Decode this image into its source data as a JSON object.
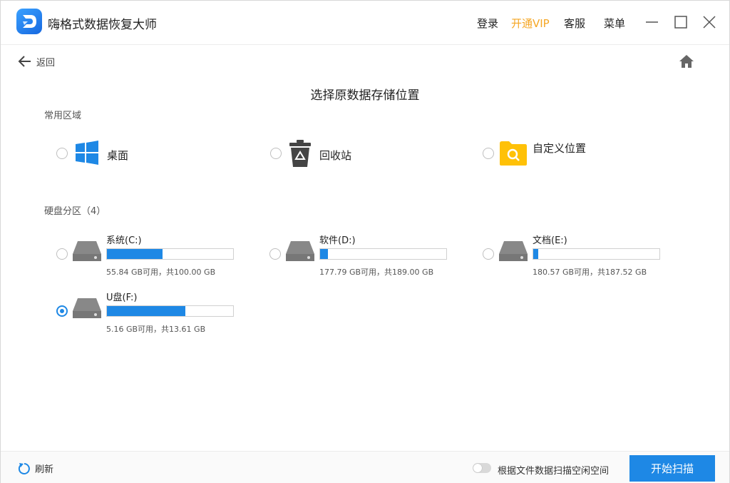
{
  "app": {
    "title": "嗨格式数据恢复大师"
  },
  "topnav": {
    "login": "登录",
    "vip": "开通VIP",
    "service": "客服",
    "menu": "菜单"
  },
  "nav": {
    "back": "返回"
  },
  "page": {
    "title": "选择原数据存储位置"
  },
  "common": {
    "label": "常用区域",
    "items": [
      {
        "label": "桌面",
        "icon": "windows-icon"
      },
      {
        "label": "回收站",
        "icon": "recycle-bin-icon"
      },
      {
        "label": "自定义位置",
        "icon": "custom-folder-icon"
      }
    ]
  },
  "partitions": {
    "label": "硬盘分区（4）",
    "items": [
      {
        "name": "系统(C:)",
        "capacity": "55.84 GB可用，共100.00 GB",
        "used_fraction": 0.44,
        "selected": false
      },
      {
        "name": "软件(D:)",
        "capacity": "177.79 GB可用，共189.00 GB",
        "used_fraction": 0.06,
        "selected": false
      },
      {
        "name": "文档(E:)",
        "capacity": "180.57 GB可用，共187.52 GB",
        "used_fraction": 0.04,
        "selected": false
      },
      {
        "name": "U盘(F:)",
        "capacity": "5.16 GB可用，共13.61 GB",
        "used_fraction": 0.62,
        "selected": true
      }
    ]
  },
  "footer": {
    "refresh": "刷新",
    "toggle_label": "根据文件数据扫描空闲空间",
    "toggle_on": false,
    "start": "开始扫描"
  },
  "colors": {
    "accent": "#1e88e5",
    "vip": "#f5a623",
    "folder": "#ffc107"
  }
}
